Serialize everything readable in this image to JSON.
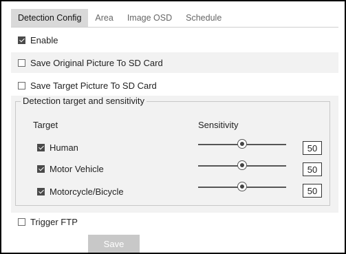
{
  "tabs": [
    {
      "label": "Detection Config",
      "active": true
    },
    {
      "label": "Area",
      "active": false
    },
    {
      "label": "Image OSD",
      "active": false
    },
    {
      "label": "Schedule",
      "active": false
    }
  ],
  "options": {
    "enable": {
      "label": "Enable",
      "checked": true
    },
    "save_original": {
      "label": "Save Original Picture To SD Card",
      "checked": false
    },
    "save_target": {
      "label": "Save Target Picture To SD Card",
      "checked": false
    },
    "trigger_ftp": {
      "label": "Trigger FTP",
      "checked": false
    }
  },
  "detection_group": {
    "legend": "Detection target and sensitivity",
    "col_target": "Target",
    "col_sensitivity": "Sensitivity",
    "targets": [
      {
        "label": "Human",
        "checked": true,
        "sensitivity": "50",
        "percent": 50
      },
      {
        "label": "Motor Vehicle",
        "checked": true,
        "sensitivity": "50",
        "percent": 50
      },
      {
        "label": "Motorcycle/Bicycle",
        "checked": true,
        "sensitivity": "50",
        "percent": 50
      }
    ]
  },
  "save_button": "Save",
  "colors": {
    "accent": "#d9d9d9",
    "band": "#f2f2f2",
    "button": "#c8c8c8"
  }
}
